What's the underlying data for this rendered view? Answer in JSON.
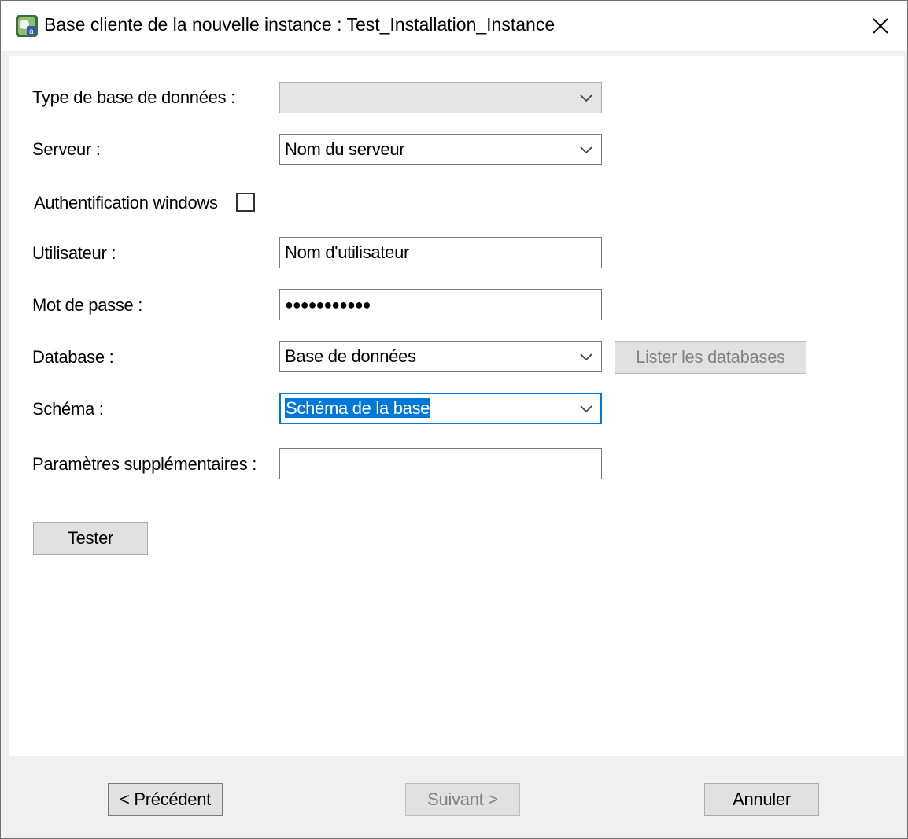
{
  "window": {
    "title": "Base cliente de la nouvelle instance : Test_Installation_Instance",
    "close_icon": "close-icon",
    "app_icon": "app-icon"
  },
  "form": {
    "db_type": {
      "label": "Type de base de données :",
      "value": ""
    },
    "server": {
      "label": "Serveur :",
      "value": "Nom du serveur"
    },
    "windows_auth": {
      "label": "Authentification windows",
      "checked": false
    },
    "user": {
      "label": "Utilisateur :",
      "value": "Nom d'utilisateur"
    },
    "password": {
      "label": "Mot de passe :",
      "value": "●●●●●●●●●●●"
    },
    "database": {
      "label": "Database :",
      "value": "Base de données",
      "list_button": "Lister les databases"
    },
    "schema": {
      "label": "Schéma :",
      "value": "Schéma de la base"
    },
    "extra_params": {
      "label": "Paramètres supplémentaires :",
      "value": ""
    },
    "test_button": "Tester"
  },
  "footer": {
    "previous": "< Précédent",
    "next": "Suivant >",
    "cancel": "Annuler"
  },
  "colors": {
    "focus": "#0078d7",
    "selection": "#0078d7"
  }
}
